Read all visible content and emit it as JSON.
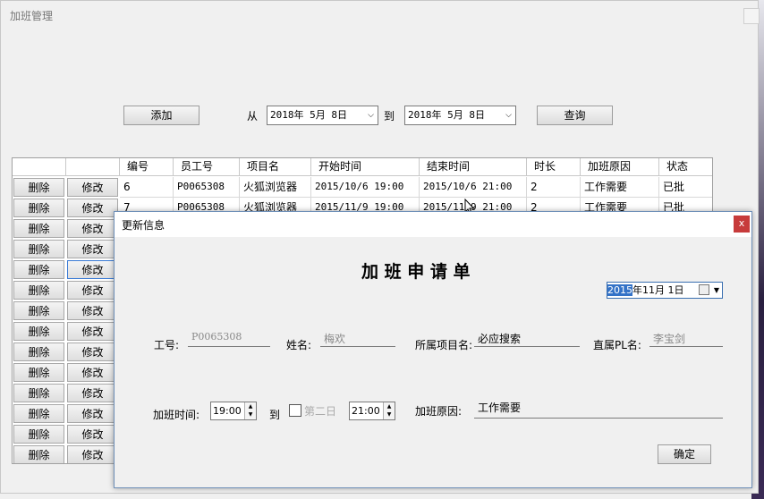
{
  "main": {
    "title": "加班管理",
    "add_label": "添加",
    "from_label": "从",
    "to_label": "到",
    "query_label": "查询",
    "date_from": "2018年 5月 8日",
    "date_to": "2018年 5月 8日",
    "grid": {
      "headers": [
        "编号",
        "员工号",
        "项目名",
        "开始时间",
        "结束时间",
        "时长",
        "加班原因",
        "状态"
      ],
      "delete_label": "删除",
      "edit_label": "修改",
      "rows": [
        [
          "6",
          "P0065308",
          "火狐浏览器",
          "2015/10/6 19:00",
          "2015/10/6 21:00",
          "2",
          "工作需要",
          "已批"
        ],
        [
          "7",
          "P0065308",
          "火狐浏览器",
          "2015/11/9 19:00",
          "2015/11/9 21:00",
          "2",
          "工作需要",
          "已批"
        ]
      ],
      "button_row_count": 14
    }
  },
  "dialog": {
    "title": "更新信息",
    "close": "x",
    "heading": "加 班 申 请 单",
    "date_selected": "2015",
    "date_rest": "年11月 1日",
    "fields": {
      "emp_no_label": "工号:",
      "emp_no": "P0065308",
      "name_label": "姓名:",
      "name": "梅欢",
      "project_label": "所属项目名:",
      "project": "必应搜索",
      "pl_label": "直属PL名:",
      "pl": "李宝剑",
      "ot_time_label": "加班时间:",
      "start_time": "19:00",
      "to_label": "到",
      "next_day_label": "第二日",
      "end_time": "21:00",
      "reason_label": "加班原因:",
      "reason": "工作需要"
    },
    "confirm_label": "确定"
  }
}
